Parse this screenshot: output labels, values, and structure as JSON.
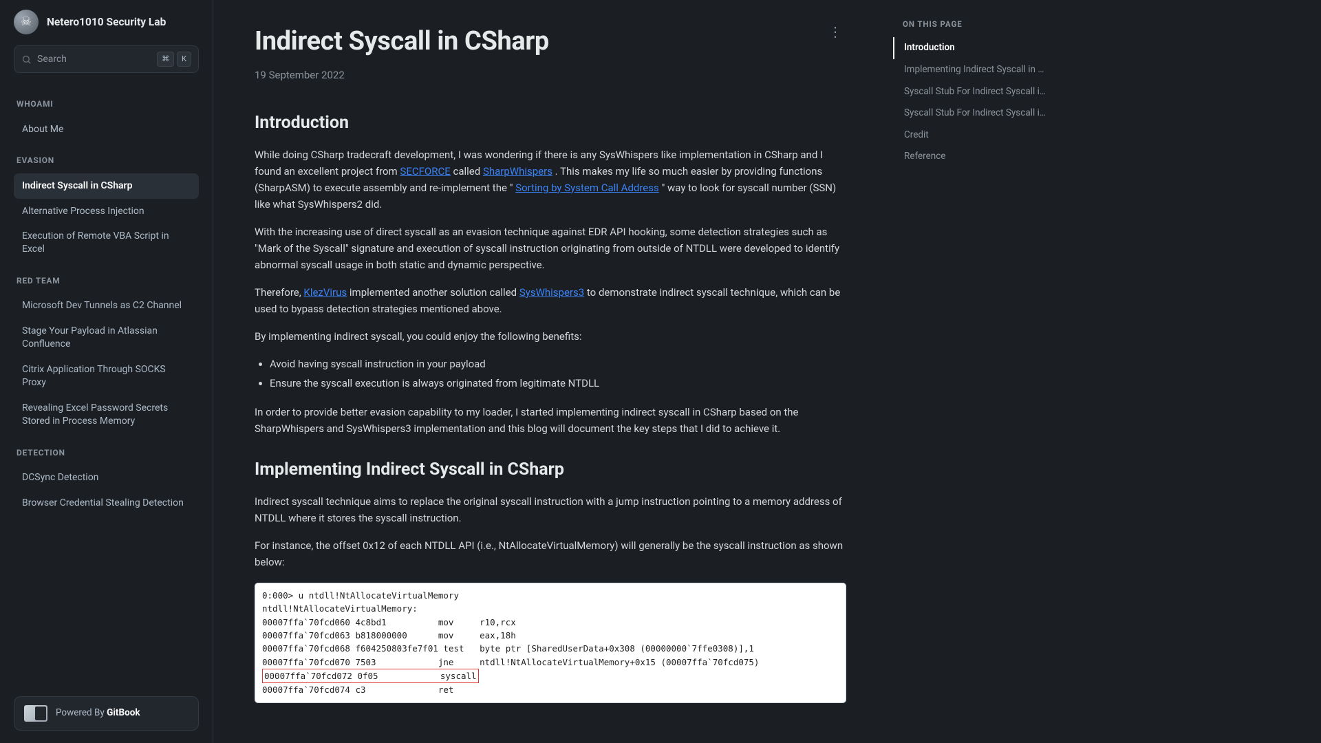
{
  "brand": {
    "title": "Netero1010 Security Lab"
  },
  "search": {
    "placeholder": "Search",
    "kbd1": "⌘",
    "kbd2": "K"
  },
  "sidebar": {
    "sections": [
      {
        "label": "WHOAMI",
        "items": [
          {
            "label": "About Me"
          }
        ]
      },
      {
        "label": "EVASION",
        "items": [
          {
            "label": "Indirect Syscall in CSharp",
            "active": true
          },
          {
            "label": "Alternative Process Injection"
          },
          {
            "label": "Execution of Remote VBA Script in Excel"
          }
        ]
      },
      {
        "label": "RED TEAM",
        "items": [
          {
            "label": "Microsoft Dev Tunnels as C2 Channel"
          },
          {
            "label": "Stage Your Payload in Atlassian Confluence"
          },
          {
            "label": "Citrix Application Through SOCKS Proxy"
          },
          {
            "label": "Revealing Excel Password Secrets Stored in Process Memory"
          }
        ]
      },
      {
        "label": "DETECTION",
        "items": [
          {
            "label": "DCSync Detection"
          },
          {
            "label": "Browser Credential Stealing Detection"
          }
        ]
      }
    ]
  },
  "powered": {
    "prefix": "Powered By ",
    "name": "GitBook"
  },
  "article": {
    "title": "Indirect Syscall in CSharp",
    "date": "19 September 2022",
    "h_intro": "Introduction",
    "p1a": "While doing CSharp tradecraft development, I was wondering if there is any SysWhispers like implementation in CSharp and I found an excellent project from ",
    "link_secforce": "SECFORCE",
    "p1b": " called ",
    "link_sharpwhispers": "SharpWhispers",
    "p1c": ". This makes my life so much easier by providing functions (SharpASM) to execute assembly and re-implement the \"",
    "link_sorting": "Sorting by System Call Address",
    "p1d": "\" way to look for syscall number (SSN) like what SysWhispers2 did.",
    "p2": "With the increasing use of direct syscall as an evasion technique against EDR API hooking, some detection strategies such as \"Mark of the Syscall\" signature and execution of syscall instruction originating from outside of NTDLL were developed to identify abnormal syscall usage in both static and dynamic perspective.",
    "p3a": "Therefore, ",
    "link_klezvirus": "KlezVirus",
    "p3b": " implemented another solution called ",
    "link_sw3": "SysWhispers3",
    "p3c": " to demonstrate indirect syscall technique, which can be used to bypass detection strategies mentioned above.",
    "p4": "By implementing indirect syscall, you could enjoy the following benefits:",
    "bul1": "Avoid having syscall instruction in your payload",
    "bul2": "Ensure the syscall execution is always originated from legitimate NTDLL",
    "p5": "In order to provide better evasion capability to my loader, I started implementing indirect syscall in CSharp based on the SharpWhispers and SysWhispers3 implementation and this blog will document the key steps that I did to achieve it.",
    "h_impl": "Implementing Indirect Syscall in CSharp",
    "p6": "Indirect syscall technique aims to replace the original syscall instruction with a jump instruction pointing to a memory address of NTDLL where it stores the syscall instruction.",
    "p7": "For instance, the offset 0x12 of each NTDLL API (i.e., NtAllocateVirtualMemory) will generally be the syscall instruction as shown below:",
    "code": {
      "l1": "0:000> u ntdll!NtAllocateVirtualMemory",
      "l2": "ntdll!NtAllocateVirtualMemory:",
      "l3": "00007ffa`70fcd060 4c8bd1          mov     r10,rcx",
      "l4": "00007ffa`70fcd063 b818000000      mov     eax,18h",
      "l5": "00007ffa`70fcd068 f604250803fe7f01 test   byte ptr [SharedUserData+0x308 (00000000`7ffe0308)],1",
      "l6": "00007ffa`70fcd070 7503            jne     ntdll!NtAllocateVirtualMemory+0x15 (00007ffa`70fcd075)",
      "l7": "00007ffa`70fcd072 0f05            syscall",
      "l8": "00007ffa`70fcd074 c3              ret"
    }
  },
  "toc": {
    "label": "ON THIS PAGE",
    "items": [
      {
        "label": "Introduction",
        "active": true
      },
      {
        "label": "Implementing Indirect Syscall in …"
      },
      {
        "label": "Syscall Stub For Indirect Syscall i…"
      },
      {
        "label": "Syscall Stub For Indirect Syscall i…"
      },
      {
        "label": "Credit"
      },
      {
        "label": "Reference"
      }
    ]
  }
}
